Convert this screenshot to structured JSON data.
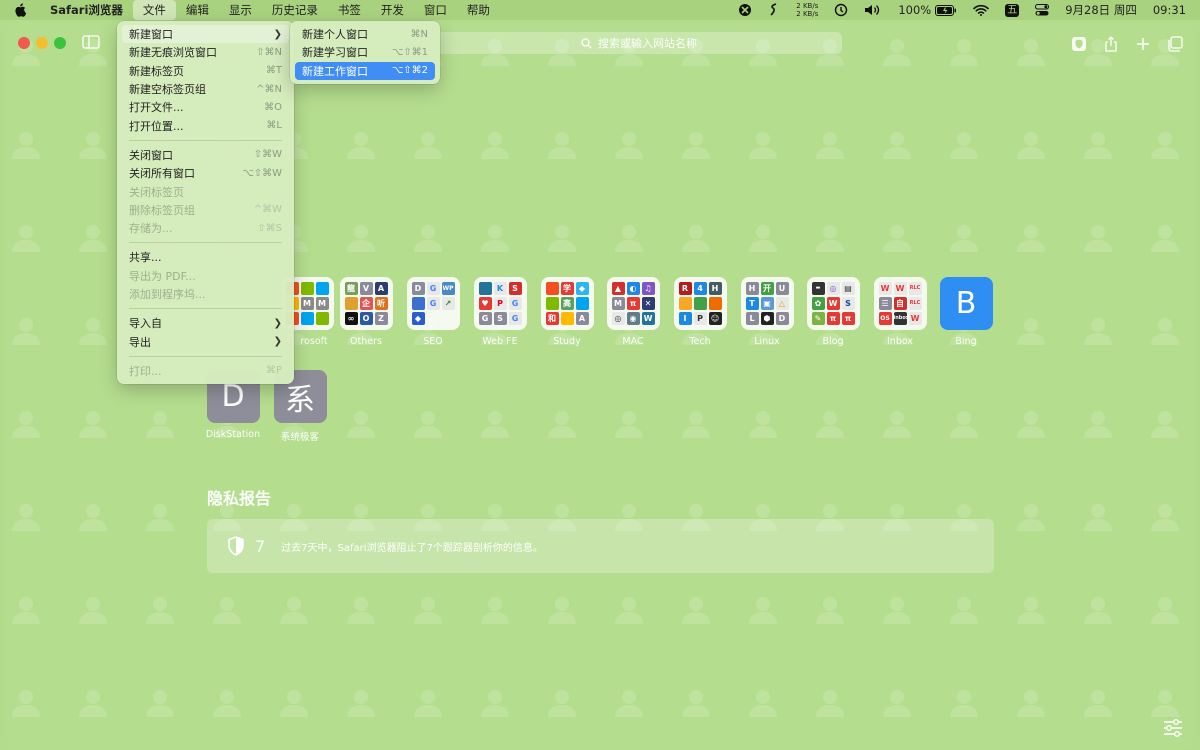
{
  "menubar": {
    "app_name": "Safari浏览器",
    "items": [
      "文件",
      "编辑",
      "显示",
      "历史记录",
      "书签",
      "开发",
      "窗口",
      "帮助"
    ],
    "net_up": "2 KB/s",
    "net_down": "2 KB/s",
    "battery": "100%",
    "input_method": "五",
    "date": "9月28日 周四",
    "time": "09:31"
  },
  "toolbar": {
    "search_placeholder": "搜索或输入网站名称"
  },
  "file_menu": {
    "items": [
      {
        "label": "新建窗口",
        "shortcut": ""
      },
      {
        "label": "新建无痕浏览窗口",
        "shortcut": "⇧⌘N"
      },
      {
        "label": "新建标签页",
        "shortcut": "⌘T"
      },
      {
        "label": "新建空标签页组",
        "shortcut": "^⌘N"
      },
      {
        "label": "打开文件...",
        "shortcut": "⌘O"
      },
      {
        "label": "打开位置...",
        "shortcut": "⌘L"
      },
      {
        "label": "关闭窗口",
        "shortcut": "⇧⌘W"
      },
      {
        "label": "关闭所有窗口",
        "shortcut": "⌥⇧⌘W"
      },
      {
        "label": "关闭标签页",
        "shortcut": ""
      },
      {
        "label": "删除标签页组",
        "shortcut": "^⌘W"
      },
      {
        "label": "存储为...",
        "shortcut": "⇧⌘S"
      },
      {
        "label": "共享...",
        "shortcut": ""
      },
      {
        "label": "导出为 PDF...",
        "shortcut": ""
      },
      {
        "label": "添加到程序坞...",
        "shortcut": ""
      },
      {
        "label": "导入自",
        "shortcut": ""
      },
      {
        "label": "导出",
        "shortcut": ""
      },
      {
        "label": "打印...",
        "shortcut": "⌘P"
      }
    ]
  },
  "submenu": {
    "items": [
      {
        "label": "新建个人窗口",
        "shortcut": "⌘N"
      },
      {
        "label": "新建学习窗口",
        "shortcut": "⌥⇧⌘1"
      },
      {
        "label": "新建工作窗口",
        "shortcut": "⌥⇧⌘2"
      }
    ]
  },
  "favorites": {
    "items": [
      "rosoft",
      "Others",
      "SEO",
      "Web FE",
      "Study",
      "MAC",
      "Tech",
      "Linux",
      "Blog",
      "Inbox",
      "Bing",
      "DiskStation",
      "系统极客"
    ],
    "bing_letter": "B",
    "disk_letter": "D",
    "xitong_letter": "系"
  },
  "tile_glyphs": {
    "others": [
      "龍",
      "V",
      "A",
      "",
      "企",
      "听",
      "∞",
      "O",
      "Z"
    ],
    "seo": [
      "D",
      "G",
      "WP",
      "",
      "G",
      "",
      "",
      "",
      ""
    ],
    "webfe": [
      "",
      "K",
      "S",
      "",
      "",
      "G",
      "G",
      "S",
      "G"
    ],
    "study": [
      "",
      "学",
      "",
      "",
      "高",
      "",
      "和",
      "",
      "A"
    ],
    "mac": [
      "",
      "",
      "",
      "M",
      "π",
      "",
      "",
      "",
      "W"
    ],
    "tech": [
      "R",
      "4",
      "H",
      "",
      "",
      "",
      "I",
      "P",
      ""
    ],
    "linux": [
      "H",
      "开",
      "U",
      "T",
      "",
      "",
      "L",
      "",
      "D"
    ],
    "blog": [
      "",
      "",
      "",
      "",
      "W",
      "S",
      "",
      "π",
      "π"
    ],
    "inbox": [
      "W",
      "W",
      "",
      "",
      "自",
      "",
      "OS",
      "",
      ""
    ]
  },
  "privacy": {
    "title": "隐私报告",
    "count": "7",
    "text": "过去7天中，Safari浏览器阻止了7个跟踪器剖析你的信息。"
  },
  "colors": {
    "background": "#b3dc8c",
    "highlight": "#3f8df5",
    "bing": "#2f8ef3",
    "gray_tile": "#8e8e9a"
  }
}
